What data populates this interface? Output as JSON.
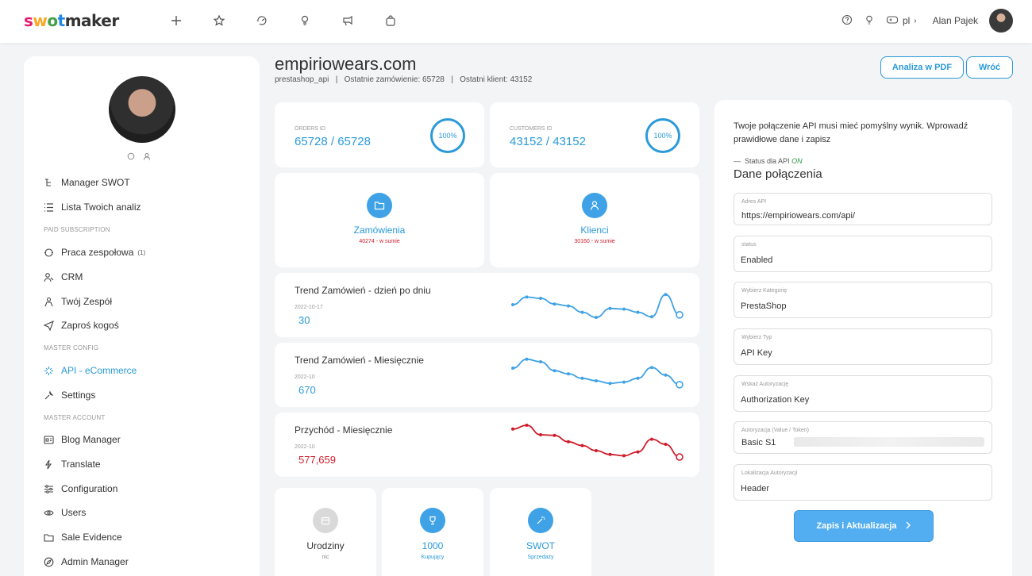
{
  "brand": {
    "logo_parts": [
      "s",
      "w",
      "o",
      "t",
      "maker"
    ]
  },
  "topbar": {
    "icons": [
      "plus-icon",
      "star-icon",
      "refresh-icon",
      "bulb-icon",
      "megaphone-icon",
      "shopping-bag-icon"
    ],
    "lang": "pl",
    "user_name": "Alan Pajek"
  },
  "sidebar": {
    "items_top": [
      {
        "label": "Manager SWOT",
        "icon": "tree-icon"
      },
      {
        "label": "Lista Twoich analiz",
        "icon": "list-icon"
      }
    ],
    "section_paid": "Paid Subscription",
    "items_paid": [
      {
        "label": "Praca zespołowa",
        "badge": "(1)",
        "icon": "team-icon"
      },
      {
        "label": "CRM",
        "icon": "crm-icon"
      },
      {
        "label": "Twój Zespół",
        "icon": "users-group-icon"
      },
      {
        "label": "Zaproś kogoś",
        "icon": "send-icon"
      }
    ],
    "section_master": "Master Config",
    "items_master": [
      {
        "label": "API - eCommerce",
        "icon": "api-icon",
        "active": true
      },
      {
        "label": "Settings",
        "icon": "wrench-icon"
      }
    ],
    "section_account": "Master Account",
    "items_account": [
      {
        "label": "Blog Manager",
        "icon": "blog-icon"
      },
      {
        "label": "Translate",
        "icon": "lightning-icon"
      },
      {
        "label": "Configuration",
        "icon": "sliders-icon"
      },
      {
        "label": "Users",
        "icon": "eye-icon"
      },
      {
        "label": "Sale Evidence",
        "icon": "folder-icon"
      },
      {
        "label": "Admin Manager",
        "icon": "compass-icon"
      }
    ]
  },
  "header": {
    "title": "empiriowears.com",
    "meta": "prestashop_api   |   Ostatnie zamówienie: 65728   |   Ostatni klient: 43152",
    "pdf_button": "Analiza w PDF",
    "back_button": "Wróć"
  },
  "stats": {
    "orders": {
      "label": "Orders ID",
      "value": "65728 / 65728",
      "percent": "100%"
    },
    "customers": {
      "label": "Customers ID",
      "value": "43152 / 43152",
      "percent": "100%"
    }
  },
  "summary": {
    "orders": {
      "title": "Zamówienia",
      "sub": "40274 - w sumie"
    },
    "clients": {
      "title": "Klienci",
      "sub": "30160 - w sumie"
    }
  },
  "trends": [
    {
      "title": "Trend Zamówień - dzień po dniu",
      "date": "2022-10-17",
      "value": "30",
      "color": "#3fa2e6",
      "points": [
        40,
        52,
        50,
        41,
        38,
        28,
        20,
        34,
        33,
        28,
        21,
        56,
        24
      ]
    },
    {
      "title": "Trend Zamówień - Miesięcznie",
      "date": "2022-10",
      "value": "670",
      "color": "#3fa2e6",
      "points": [
        50,
        64,
        60,
        46,
        41,
        34,
        30,
        26,
        28,
        34,
        51,
        39,
        24
      ]
    },
    {
      "title": "Przychód - Miesięcznie",
      "date": "2022-10",
      "value": "577,659",
      "color": "#d01c2a",
      "points": [
        64,
        70,
        55,
        54,
        44,
        38,
        30,
        24,
        22,
        28,
        48,
        40,
        20
      ]
    }
  ],
  "tiles": [
    {
      "title": "Urodziny",
      "sub": "nic",
      "icon": "calendar-icon",
      "color": "#d7d7d7",
      "title_color": "#333"
    },
    {
      "title": "1000",
      "sub": "Kupujący",
      "icon": "trophy-icon",
      "color": "#3fa2e6",
      "title_color": "#2a9ad8"
    },
    {
      "title": "SWOT",
      "sub": "Sprzedaży",
      "icon": "magic-wand-icon",
      "color": "#3fa2e6",
      "title_color": "#2a9ad8"
    }
  ],
  "api_panel": {
    "info": "Twoje połączenie API musi mieć pomyślny wynik. Wprowadź prawidłowe dane i zapisz",
    "status_label": "Status dla API",
    "status_value": "ON",
    "heading": "Dane połączenia",
    "fields": [
      {
        "label": "Adres API",
        "value": "https://empiriowears.com/api/"
      },
      {
        "label": "status",
        "value": "Enabled"
      },
      {
        "label": "Wybierz Kategorię",
        "value": "PrestaShop"
      },
      {
        "label": "Wybierz Typ",
        "value": "API Key"
      },
      {
        "label": "Wskaż Autoryzację",
        "value": "Authorization Key"
      },
      {
        "label": "Autoryzacja (Value / Token)",
        "value": "Basic S1"
      },
      {
        "label": "Lokalizacja Autoryzacji",
        "value": "Header"
      }
    ],
    "save_button": "Zapis i Aktualizacja"
  }
}
